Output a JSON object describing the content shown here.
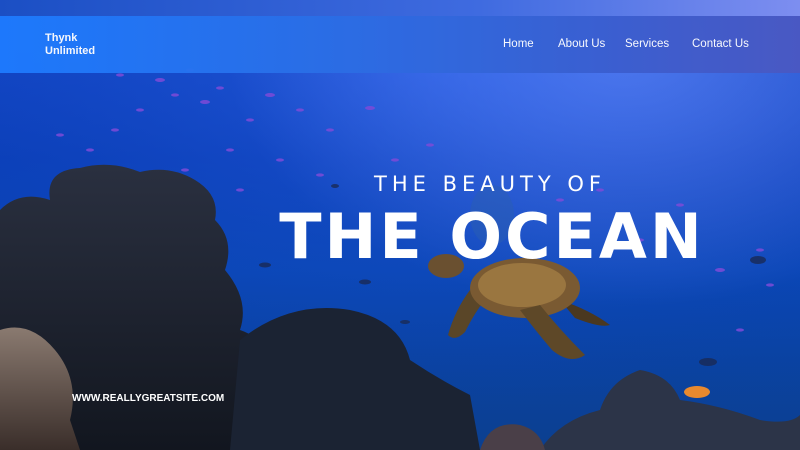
{
  "nav": {
    "brand": "Thynk\nUnlimited",
    "links": [
      "Home",
      "About Us",
      "Services",
      "Contact Us"
    ]
  },
  "hero": {
    "subtitle": "THE BEAUTY OF",
    "title": "THE OCEAN"
  },
  "footer": {
    "website": "WWW.REALLYGREATSITE.COM"
  },
  "colors": {
    "nav_gradient_start": "#1e7bff",
    "nav_gradient_end": "#4a58c2",
    "ocean": "#0b3fb8",
    "text": "#ffffff"
  }
}
